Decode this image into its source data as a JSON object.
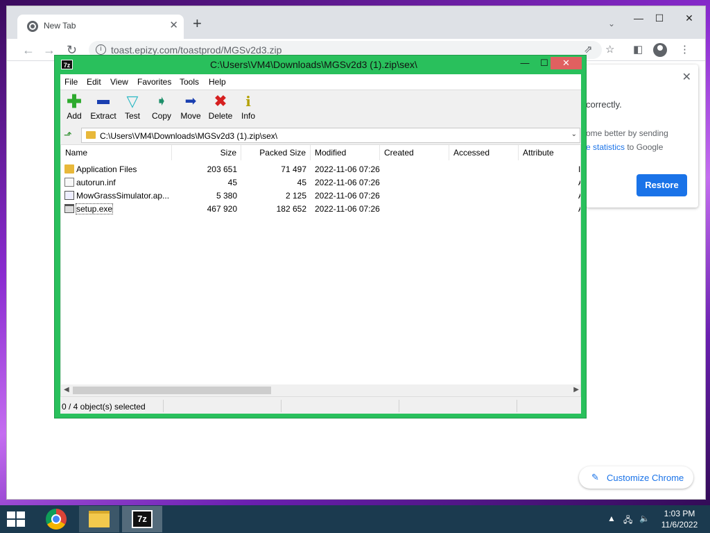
{
  "chrome": {
    "tab_title": "New Tab",
    "url": "toast.epizy.com/toastprod/MGSv2d3.zip",
    "restore": {
      "line1": "correctly.",
      "line2": "ome better by sending",
      "line3_link": "e statistics",
      "line3_rest": " to Google",
      "button": "Restore"
    },
    "customize_label": "Customize Chrome"
  },
  "zip": {
    "title": "C:\\Users\\VM4\\Downloads\\MGSv2d3 (1).zip\\sex\\",
    "app_icon_label": "7z",
    "menu": [
      "File",
      "Edit",
      "View",
      "Favorites",
      "Tools",
      "Help"
    ],
    "toolbar": [
      {
        "label": "Add",
        "icon": "plus-icon",
        "color": "#2eaa2e"
      },
      {
        "label": "Extract",
        "icon": "minus-icon",
        "color": "#1a3fb0"
      },
      {
        "label": "Test",
        "icon": "check-icon",
        "color": "#2ab8c4"
      },
      {
        "label": "Copy",
        "icon": "double-arrow-icon",
        "color": "#1e8f6a"
      },
      {
        "label": "Move",
        "icon": "arrow-right-icon",
        "color": "#1a3fb0"
      },
      {
        "label": "Delete",
        "icon": "x-icon",
        "color": "#d62020"
      },
      {
        "label": "Info",
        "icon": "info-icon",
        "color": "#d4c000"
      }
    ],
    "address": "C:\\Users\\VM4\\Downloads\\MGSv2d3 (1).zip\\sex\\",
    "columns": [
      "Name",
      "Size",
      "Packed Size",
      "Modified",
      "Created",
      "Accessed",
      "Attribute"
    ],
    "rows": [
      {
        "name": "Application Files",
        "size": "203 651",
        "packed": "71 497",
        "modified": "2022-11-06 07:26",
        "attr": "I",
        "icon": "folder"
      },
      {
        "name": "autorun.inf",
        "size": "45",
        "packed": "45",
        "modified": "2022-11-06 07:26",
        "attr": "A",
        "icon": "doc"
      },
      {
        "name": "MowGrassSimulator.ap...",
        "size": "5 380",
        "packed": "2 125",
        "modified": "2022-11-06 07:26",
        "attr": "A",
        "icon": "app"
      },
      {
        "name": "setup.exe",
        "size": "467 920",
        "packed": "182 652",
        "modified": "2022-11-06 07:26",
        "attr": "A",
        "icon": "exe"
      }
    ],
    "status": "0 / 4 object(s) selected"
  },
  "taskbar": {
    "zip_label": "7z",
    "time": "1:03 PM",
    "date": "11/6/2022"
  }
}
